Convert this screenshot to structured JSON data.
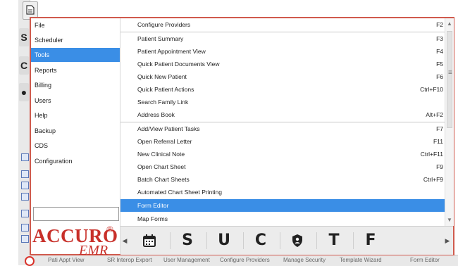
{
  "left_menu": {
    "items": [
      {
        "label": "File"
      },
      {
        "label": "Scheduler"
      },
      {
        "label": "Tools"
      },
      {
        "label": "Reports"
      },
      {
        "label": "Billing"
      },
      {
        "label": "Users"
      },
      {
        "label": "Help"
      },
      {
        "label": "Backup"
      },
      {
        "label": "CDS"
      },
      {
        "label": "Configuration"
      }
    ],
    "selected": "Tools",
    "search_value": ""
  },
  "logo": {
    "name": "ACCURO",
    "mark": "®",
    "sub": "EMR"
  },
  "tools_menu": {
    "items": [
      {
        "label": "Configure Providers",
        "shortcut": "F2"
      },
      {
        "label": "Patient Summary",
        "shortcut": "F3"
      },
      {
        "label": "Patient Appointment View",
        "shortcut": "F4"
      },
      {
        "label": "Quick Patient Documents View",
        "shortcut": "F5"
      },
      {
        "label": "Quick New Patient",
        "shortcut": "F6"
      },
      {
        "label": "Quick Patient Actions",
        "shortcut": "Ctrl+F10"
      },
      {
        "label": "Search Family Link",
        "shortcut": ""
      },
      {
        "label": "Address Book",
        "shortcut": "Alt+F2"
      },
      {
        "label": "Add/View Patient Tasks",
        "shortcut": "F7"
      },
      {
        "label": "Open Referral Letter",
        "shortcut": "F11"
      },
      {
        "label": "New Clinical Note",
        "shortcut": "Ctrl+F11"
      },
      {
        "label": "Open Chart Sheet",
        "shortcut": "F9"
      },
      {
        "label": "Batch Chart Sheets",
        "shortcut": "Ctrl+F9"
      },
      {
        "label": "Automated Chart Sheet Printing",
        "shortcut": ""
      },
      {
        "label": "Form Editor",
        "shortcut": ""
      },
      {
        "label": "Map Forms",
        "shortcut": ""
      }
    ],
    "selected": "Form Editor"
  },
  "toolbar": {
    "buttons": [
      {
        "icon": "calendar-icon",
        "label": ""
      },
      {
        "icon": "letter-s",
        "label": "S"
      },
      {
        "icon": "letter-u",
        "label": "U"
      },
      {
        "icon": "letter-c",
        "label": "C"
      },
      {
        "icon": "shield-icon",
        "label": ""
      },
      {
        "icon": "letter-t",
        "label": "T"
      },
      {
        "icon": "letter-f",
        "label": "F"
      }
    ]
  },
  "background_strip": {
    "labels": [
      "Pati Appt View",
      "SR Interop Export",
      "User Management",
      "Configure Providers",
      "Manage Security",
      "Template Wizard",
      "Form Editor"
    ]
  },
  "colors": {
    "accent": "#3a8ee6",
    "frame": "#d05a4d",
    "logo": "#c8302a"
  }
}
